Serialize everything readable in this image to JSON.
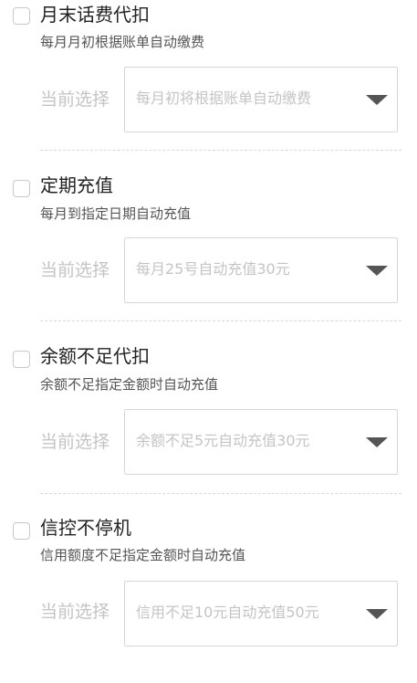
{
  "options": [
    {
      "title": "月末话费代扣",
      "description": "每月月初根据账单自动缴费",
      "current_label": "当前选择",
      "select_value": "每月初将根据账单自动缴费"
    },
    {
      "title": "定期充值",
      "description": "每月到指定日期自动充值",
      "current_label": "当前选择",
      "select_value": "每月25号自动充值30元"
    },
    {
      "title": "余额不足代扣",
      "description": "余额不足指定金额时自动充值",
      "current_label": "当前选择",
      "select_value": "余额不足5元自动充值30元"
    },
    {
      "title": "信控不停机",
      "description": "信用额度不足指定金额时自动充值",
      "current_label": "当前选择",
      "select_value": "信用不足10元自动充值50元"
    }
  ]
}
